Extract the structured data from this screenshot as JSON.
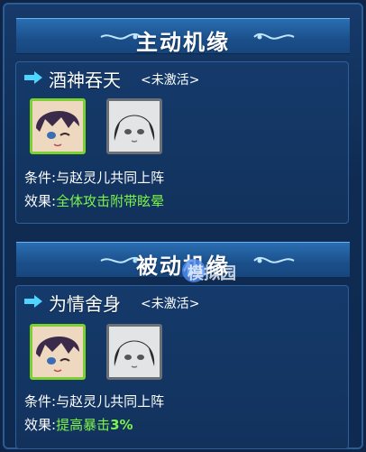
{
  "sections": {
    "active_title": "主动机缘",
    "passive_title": "被动机缘"
  },
  "active_skill": {
    "name": "酒神吞天",
    "status": "<未激活>",
    "condition_label": "条件:",
    "condition_value": "与赵灵儿共同上阵",
    "effect_label": "效果:",
    "effect_value": "全体攻击附带眩晕"
  },
  "passive_skill": {
    "name": "为情舍身",
    "status": "<未激活>",
    "condition_label": "条件:",
    "condition_value": "与赵灵儿共同上阵",
    "effect_label": "效果:",
    "effect_value_prefix": "提高暴击",
    "effect_value_number": "3%"
  },
  "watermark": "模拟园",
  "icons": {
    "arrow": "arrow-right-icon",
    "hero_portrait": "hero-portrait-icon",
    "partner_portrait": "partner-portrait-icon"
  },
  "colors": {
    "accent_green": "#7cf34a",
    "active_border": "#7cd12f",
    "arrow_cyan": "#4fd3ff"
  }
}
